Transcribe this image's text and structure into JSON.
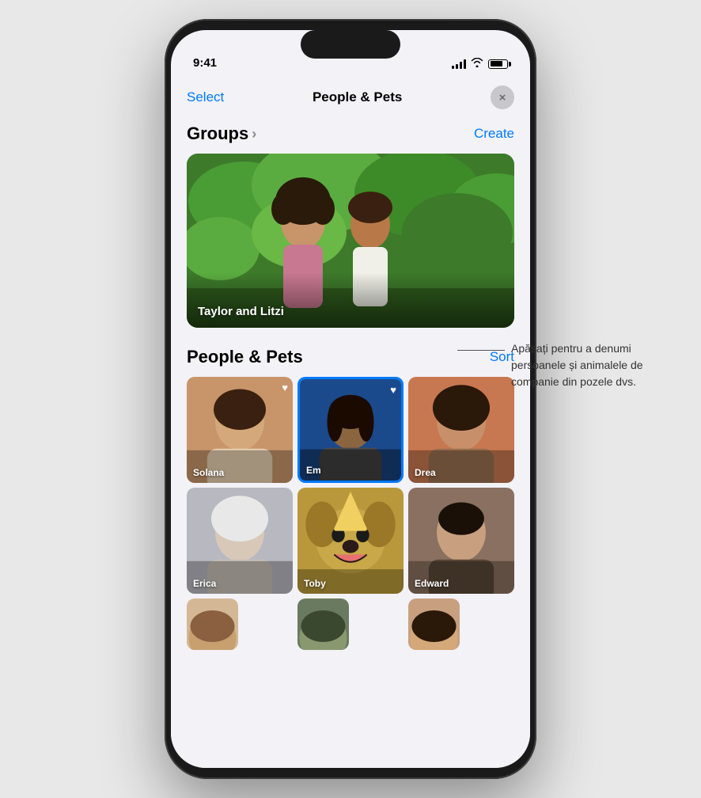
{
  "statusBar": {
    "time": "9:41",
    "signalBars": [
      4,
      6,
      8,
      10,
      12
    ],
    "wifiSymbol": "wifi",
    "batteryLevel": 75
  },
  "navBar": {
    "selectLabel": "Select",
    "title": "People & Pets",
    "closeLabel": "×"
  },
  "groups": {
    "sectionTitle": "Groups",
    "chevron": "›",
    "createLabel": "Create",
    "groupCard": {
      "label": "Taylor and Litzi"
    }
  },
  "peoplePets": {
    "sectionTitle": "People & Pets",
    "sortLabel": "Sort",
    "people": [
      {
        "name": "Solana",
        "hasFavorite": true,
        "selected": false,
        "photoClass": "photo-solana"
      },
      {
        "name": "Em",
        "hasFavorite": true,
        "selected": true,
        "photoClass": "photo-em"
      },
      {
        "name": "Drea",
        "hasFavorite": false,
        "selected": false,
        "photoClass": "photo-drea"
      },
      {
        "name": "Erica",
        "hasFavorite": false,
        "selected": false,
        "photoClass": "photo-erica"
      },
      {
        "name": "Toby",
        "hasFavorite": false,
        "selected": false,
        "photoClass": "photo-toby"
      },
      {
        "name": "Edward",
        "hasFavorite": false,
        "selected": false,
        "photoClass": "photo-edward"
      }
    ],
    "partialPeople": [
      {
        "photoClass": "photo-partial1"
      },
      {
        "photoClass": "photo-partial2"
      },
      {
        "photoClass": "photo-partial3"
      }
    ]
  },
  "tooltip": {
    "text": "Apăsați pentru a denumi persoanele și animalele de companie din pozele dvs."
  }
}
